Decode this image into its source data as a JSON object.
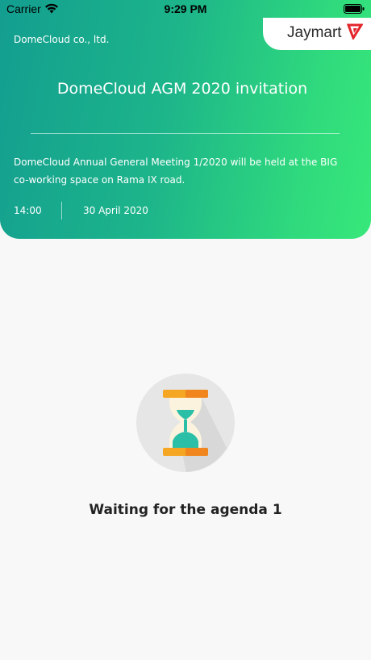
{
  "status_bar": {
    "carrier": "Carrier",
    "time": "9:29 PM"
  },
  "header": {
    "company": "DomeCloud co., ltd.",
    "brand": "Jaymart",
    "title": "DomeCloud AGM 2020 invitation",
    "description": "DomeCloud Annual General Meeting 1/2020 will be held at the BIG co-working space on Rama IX road.",
    "time": "14:00",
    "date": "30 April 2020"
  },
  "status": {
    "message": "Waiting for the agenda 1",
    "icon": "hourglass-icon"
  },
  "colors": {
    "gradient_start": "#139e90",
    "gradient_end": "#37e87a",
    "hourglass_orange": "#f5a623"
  }
}
